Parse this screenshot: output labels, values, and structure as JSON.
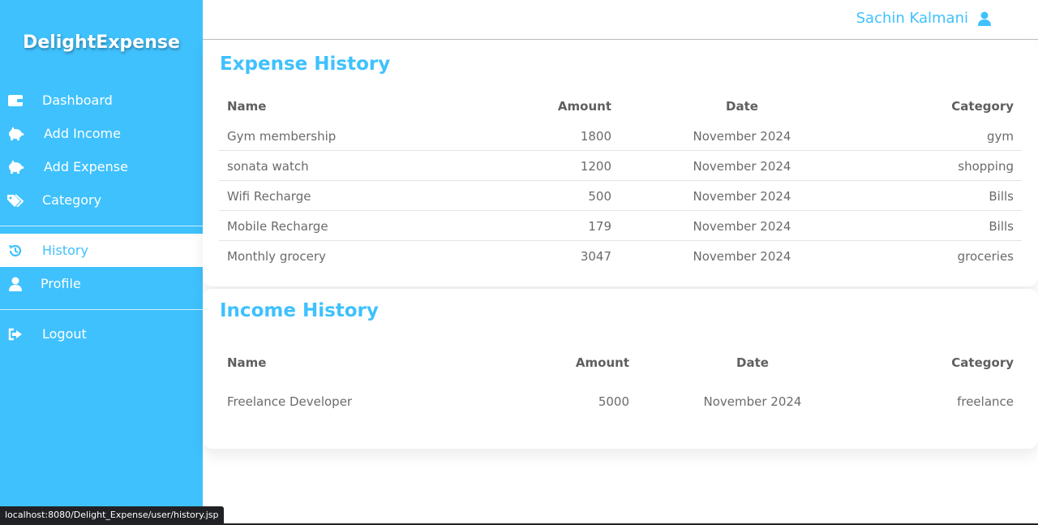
{
  "brand": "DelightExpense",
  "nav": {
    "dashboard": "Dashboard",
    "add_income": "Add Income",
    "add_expense": "Add Expense",
    "category": "Category",
    "history": "History",
    "profile": "Profile",
    "logout": "Logout"
  },
  "user": {
    "name": "Sachin Kalmani"
  },
  "expense": {
    "title": "Expense History",
    "headers": {
      "name": "Name",
      "amount": "Amount",
      "date": "Date",
      "category": "Category"
    },
    "rows": [
      {
        "name": "Gym membership",
        "amount": "1800",
        "date": "November 2024",
        "category": "gym"
      },
      {
        "name": "sonata watch",
        "amount": "1200",
        "date": "November 2024",
        "category": "shopping"
      },
      {
        "name": "Wifi Recharge",
        "amount": "500",
        "date": "November 2024",
        "category": "Bills"
      },
      {
        "name": "Mobile Recharge",
        "amount": "179",
        "date": "November 2024",
        "category": "Bills"
      },
      {
        "name": "Monthly grocery",
        "amount": "3047",
        "date": "November 2024",
        "category": "groceries"
      }
    ]
  },
  "income": {
    "title": "Income History",
    "headers": {
      "name": "Name",
      "amount": "Amount",
      "date": "Date",
      "category": "Category"
    },
    "rows": [
      {
        "name": "Freelance Developer",
        "amount": "5000",
        "date": "November 2024",
        "category": "freelance"
      }
    ]
  },
  "statusbar": "localhost:8080/Delight_Expense/user/history.jsp",
  "colors": {
    "accent": "#3fc1fd",
    "text": "#6b6b6b"
  }
}
